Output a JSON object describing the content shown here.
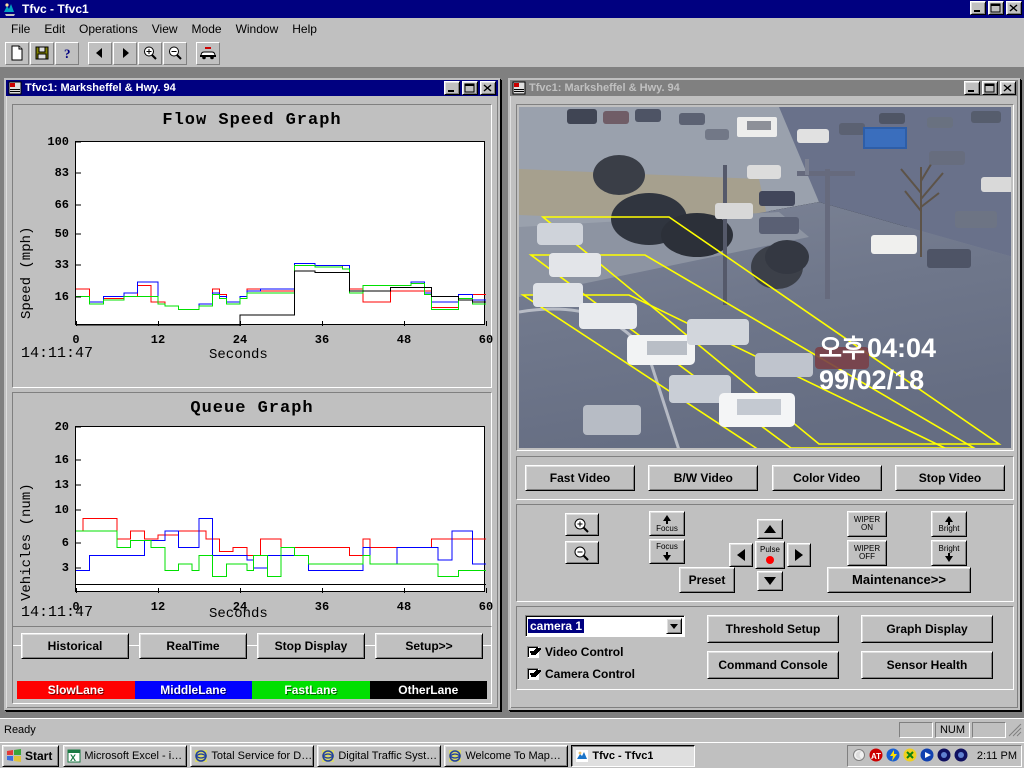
{
  "app": {
    "title": "Tfvc - Tfvc1",
    "icon": "tfvc-app-icon",
    "menu": [
      "File",
      "Edit",
      "Operations",
      "View",
      "Mode",
      "Window",
      "Help"
    ],
    "window_buttons": {
      "minimize": "_",
      "maximize": "□",
      "close": "✕"
    },
    "toolbar": [
      {
        "name": "new-icon",
        "glyph": "new-document"
      },
      {
        "name": "save-icon",
        "glyph": "floppy-disk"
      },
      {
        "name": "help-icon",
        "glyph": "question-mark"
      },
      {
        "name": "previous-icon",
        "glyph": "left-triangle"
      },
      {
        "name": "next-icon",
        "glyph": "right-triangle"
      },
      {
        "name": "zoom-in-icon",
        "glyph": "magnifier-plus"
      },
      {
        "name": "zoom-out-icon",
        "glyph": "magnifier-minus"
      },
      {
        "name": "vehicle-icon",
        "glyph": "police-car"
      }
    ]
  },
  "graph_window": {
    "title": "Tfvc1: Marksheffel & Hwy. 94",
    "active": true,
    "buttons": [
      {
        "label": "Historical",
        "name": "historical-button"
      },
      {
        "label": "RealTime",
        "name": "realtime-button"
      },
      {
        "label": "Stop Display",
        "name": "stop-display-button"
      },
      {
        "label": "Setup>>",
        "name": "setup-button"
      }
    ],
    "legend": [
      {
        "label": "SlowLane",
        "color": "#ff0000"
      },
      {
        "label": "MiddleLane",
        "color": "#0000ff"
      },
      {
        "label": "FastLane",
        "color": "#00e000"
      },
      {
        "label": "OtherLane",
        "color": "#000000"
      }
    ]
  },
  "video_window": {
    "title": "Tfvc1: Marksheffel & Hwy. 94",
    "active": false,
    "overlay": {
      "meridiem": "오후",
      "time": "04:04",
      "date": "99/02/18"
    },
    "video_buttons": [
      {
        "label": "Fast Video",
        "name": "fast-video-button"
      },
      {
        "label": "B/W Video",
        "name": "bw-video-button"
      },
      {
        "label": "Color Video",
        "name": "color-video-button"
      },
      {
        "label": "Stop Video",
        "name": "stop-video-button"
      }
    ],
    "camera_controls": {
      "zoom_in": "zoom-in-icon",
      "zoom_out": "zoom-out-icon",
      "focus_near_label": "Focus",
      "focus_far_label": "Focus",
      "pulse_label": "Pulse",
      "preset_label": "Preset",
      "maintenance_label": "Maintenance>>",
      "wiper_on_line1": "WIPER",
      "wiper_on_line2": "ON",
      "wiper_off_line1": "WIPER",
      "wiper_off_line2": "OFF",
      "bright_up_label": "Bright",
      "bright_down_label": "Bright"
    },
    "camera_select": {
      "value": "camera 1",
      "name": "camera-select"
    },
    "checkboxes": [
      {
        "label": "Video Control",
        "checked": true
      },
      {
        "label": "Camera Control",
        "checked": true
      }
    ],
    "action_buttons": [
      {
        "label": "Threshold Setup",
        "name": "threshold-setup-button"
      },
      {
        "label": "Command Console",
        "name": "command-console-button"
      },
      {
        "label": "Graph Display",
        "name": "graph-display-button"
      },
      {
        "label": "Sensor Health",
        "name": "sensor-health-button"
      }
    ]
  },
  "statusbar": {
    "message": "Ready",
    "num_indicator": "NUM"
  },
  "taskbar": {
    "start_label": "Start",
    "items": [
      {
        "label": "Microsoft Excel - int...",
        "active": false,
        "icon": "excel-icon"
      },
      {
        "label": "Total Service for Dr...",
        "active": false,
        "icon": "ie-icon"
      },
      {
        "label": "Digital Traffic Syste...",
        "active": false,
        "icon": "ie-icon"
      },
      {
        "label": "Welcome To MapQ...",
        "active": false,
        "icon": "ie-icon"
      },
      {
        "label": "Tfvc - Tfvc1",
        "active": true,
        "icon": "tfvc-app-icon"
      }
    ],
    "clock": "2:11 PM",
    "tray_icons": [
      "moon-icon",
      "ati-icon",
      "flash-icon",
      "norton-icon",
      "media-icon",
      "disk-icon",
      "disk2-icon"
    ]
  },
  "chart_data": [
    {
      "type": "line",
      "title": "Flow Speed Graph",
      "xlabel": "Seconds",
      "ylabel": "Speed (mph)",
      "timestamp": "14:11:47",
      "xlim": [
        0,
        60
      ],
      "ylim": [
        0,
        100
      ],
      "xticks": [
        0,
        12,
        24,
        36,
        48,
        60
      ],
      "yticks": [
        16,
        33,
        50,
        66,
        83,
        100
      ],
      "grid": false,
      "step": true,
      "series": [
        {
          "name": "SlowLane",
          "color": "#ff0000",
          "values": [
            20,
            20,
            13,
            13,
            15,
            15,
            15,
            16,
            16,
            22,
            22,
            13,
            13,
            11,
            11,
            9,
            9,
            9,
            12,
            12,
            20,
            17,
            12,
            12,
            16,
            20,
            20,
            19,
            19,
            19,
            19,
            19,
            34,
            34,
            34,
            33,
            33,
            33,
            33,
            31,
            20,
            20,
            13,
            13,
            13,
            13,
            19,
            19,
            19,
            19,
            19,
            19,
            10,
            10,
            10,
            10,
            17,
            17,
            17,
            17
          ]
        },
        {
          "name": "MiddleLane",
          "color": "#0000ff",
          "values": [
            16,
            16,
            13,
            13,
            16,
            16,
            16,
            18,
            18,
            24,
            24,
            24,
            12,
            11,
            11,
            9,
            9,
            9,
            12,
            12,
            18,
            16,
            13,
            13,
            16,
            19,
            19,
            20,
            20,
            20,
            20,
            20,
            34,
            34,
            34,
            33,
            33,
            33,
            33,
            33,
            19,
            19,
            22,
            22,
            22,
            22,
            22,
            22,
            22,
            24,
            24,
            18,
            13,
            13,
            13,
            13,
            17,
            17,
            14,
            14
          ]
        },
        {
          "name": "FastLane",
          "color": "#00e000",
          "values": [
            16,
            16,
            12,
            12,
            14,
            14,
            14,
            16,
            16,
            16,
            16,
            16,
            12,
            11,
            11,
            9,
            9,
            9,
            11,
            11,
            17,
            15,
            12,
            12,
            15,
            18,
            18,
            18,
            18,
            18,
            18,
            18,
            33,
            33,
            33,
            32,
            32,
            32,
            32,
            31,
            18,
            18,
            22,
            22,
            22,
            22,
            22,
            22,
            22,
            23,
            23,
            17,
            9,
            9,
            9,
            9,
            15,
            15,
            12,
            12
          ]
        },
        {
          "name": "OtherLane",
          "color": "#000000",
          "values": [
            0,
            0,
            0,
            0,
            0,
            0,
            0,
            0,
            0,
            0,
            0,
            0,
            0,
            0,
            0,
            0,
            0,
            0,
            0,
            0,
            0,
            0,
            0,
            0,
            6,
            6,
            6,
            6,
            6,
            6,
            6,
            6,
            30,
            30,
            30,
            29,
            29,
            29,
            29,
            29,
            19,
            19,
            19,
            19,
            19,
            19,
            21,
            21,
            21,
            21,
            21,
            21,
            16,
            16,
            16,
            16,
            14,
            14,
            13,
            13
          ]
        }
      ]
    },
    {
      "type": "line",
      "title": "Queue Graph",
      "xlabel": "Seconds",
      "ylabel": "Vehicles (num)",
      "timestamp": "14:11:47",
      "xlim": [
        0,
        60
      ],
      "ylim": [
        0,
        20
      ],
      "xticks": [
        0,
        12,
        24,
        36,
        48,
        60
      ],
      "yticks": [
        3,
        6,
        10,
        13,
        16,
        20
      ],
      "grid": false,
      "step": true,
      "series": [
        {
          "name": "SlowLane",
          "color": "#ff0000",
          "values": [
            7.5,
            9,
            9,
            9,
            9,
            9,
            6.5,
            6.5,
            7.5,
            7.5,
            6.5,
            6.5,
            7,
            7,
            7,
            7.5,
            7.5,
            7.5,
            7.5,
            6.5,
            6.5,
            5,
            5,
            5.5,
            5.5,
            4.5,
            4.5,
            6.5,
            6.5,
            6.5,
            4.5,
            4.5,
            5.5,
            5.5,
            5.5,
            5.5,
            5.5,
            5.5,
            5.5,
            5.5,
            4.5,
            4.5,
            6.5,
            5.5,
            5.5,
            5.5,
            5.5,
            5.5,
            5.5,
            5.5,
            5.5,
            5.5,
            6.5,
            6.5,
            6.5,
            6.5,
            6.5,
            6.5,
            6.5,
            6.5
          ]
        },
        {
          "name": "MiddleLane",
          "color": "#0000ff",
          "values": [
            2.7,
            2.7,
            4.5,
            4.5,
            4.5,
            4.5,
            4.5,
            4.5,
            4.5,
            4.5,
            6.3,
            6.3,
            6.3,
            7.5,
            7.5,
            5.5,
            5.5,
            5.5,
            9,
            9,
            4.5,
            4.5,
            4.5,
            4.5,
            4.5,
            4,
            3,
            3,
            4.5,
            4.5,
            4.5,
            4.5,
            4.5,
            4.5,
            2.7,
            2.7,
            2.7,
            2.7,
            2.7,
            2.7,
            2.7,
            2.7,
            5.5,
            3.5,
            3.5,
            3.5,
            3.5,
            5.5,
            5.5,
            5.5,
            5.5,
            5.5,
            5.5,
            4,
            4,
            7.5,
            7.5,
            7.5,
            3.5,
            3.5
          ]
        },
        {
          "name": "FastLane",
          "color": "#00e000",
          "values": [
            7.5,
            7.5,
            7.5,
            7.5,
            7.5,
            7.5,
            5.5,
            5.5,
            6.3,
            6.3,
            6.3,
            5.5,
            5.5,
            2.7,
            2.7,
            3.5,
            3.5,
            2.7,
            4.5,
            4.5,
            2,
            2,
            3.5,
            3.5,
            3.5,
            2.7,
            4.5,
            4.5,
            2,
            2,
            5.5,
            5.5,
            4.5,
            4.5,
            3.5,
            3.5,
            3.5,
            3.5,
            3.5,
            3.5,
            3.5,
            3.5,
            4.5,
            3.5,
            3.5,
            3.5,
            3.5,
            3.5,
            3.5,
            3.5,
            3.5,
            3.5,
            3.5,
            2,
            2,
            2,
            2.7,
            2.7,
            2.7,
            2.7
          ]
        },
        {
          "name": "OtherLane",
          "color": "#000000",
          "values": [
            1,
            1,
            1,
            1,
            1,
            1,
            1,
            1,
            1,
            1,
            1,
            1,
            1,
            1,
            1,
            1,
            1,
            1,
            1,
            1,
            1,
            1,
            1,
            1,
            1,
            1,
            1,
            1,
            1,
            1,
            1,
            1,
            1,
            1,
            1,
            1,
            1,
            1,
            1,
            1,
            1,
            1,
            1,
            1,
            1,
            1,
            1,
            1,
            1,
            1,
            1,
            1,
            1,
            1,
            1,
            1,
            1,
            1,
            1,
            1
          ]
        }
      ]
    }
  ]
}
